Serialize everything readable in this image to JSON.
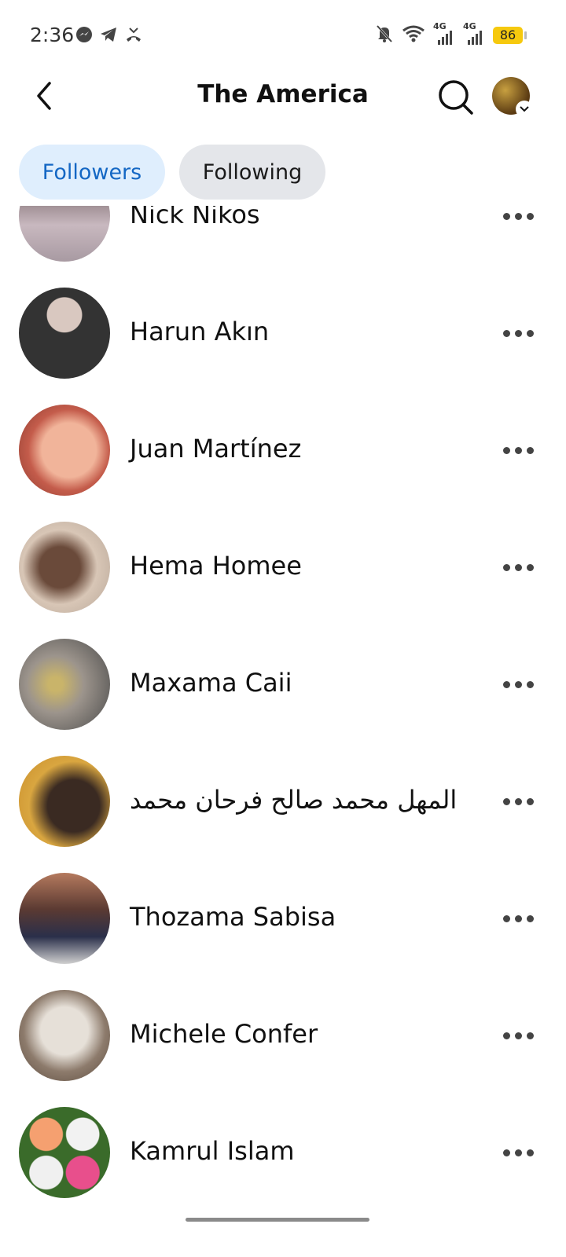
{
  "status_bar": {
    "time": "2:36",
    "left_icons": [
      "messenger-icon",
      "telegram-icon",
      "missed-call-icon"
    ],
    "right_icons": [
      "mute-bell-icon",
      "wifi-icon",
      "signal-4g-icon",
      "signal-4g-icon"
    ],
    "network_labels": [
      "4G",
      "4G"
    ],
    "battery_level": "86",
    "battery_color": "#f6c90e"
  },
  "header": {
    "title": "The America"
  },
  "tabs": [
    {
      "label": "Followers",
      "active": true
    },
    {
      "label": "Following",
      "active": false
    }
  ],
  "accent_color": "#1467c4",
  "followers": [
    {
      "name": "Nick Nikos"
    },
    {
      "name": "Harun Akın"
    },
    {
      "name": "Juan Martínez"
    },
    {
      "name": "Hema Homee"
    },
    {
      "name": "Maxama Caii"
    },
    {
      "name": "المهل محمد صالح فرحان محمد"
    },
    {
      "name": "Thozama Sabisa"
    },
    {
      "name": "Michele Confer"
    },
    {
      "name": "Kamrul Islam"
    }
  ]
}
